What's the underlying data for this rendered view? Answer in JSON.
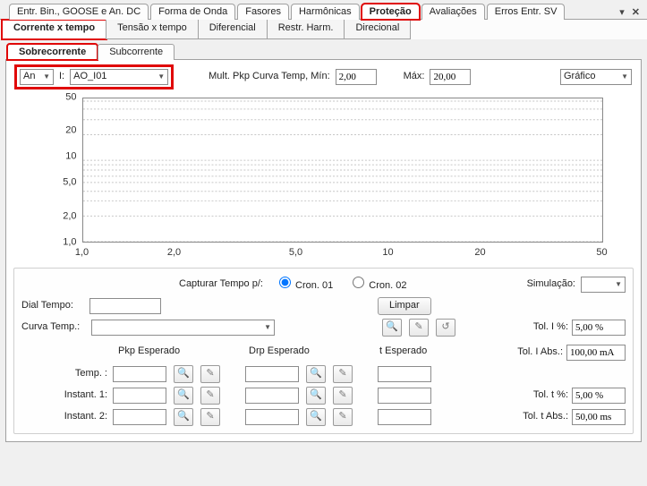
{
  "topTabs": {
    "t0": "Entr. Bin., GOOSE e An. DC",
    "t1": "Forma de Onda",
    "t2": "Fasores",
    "t3": "Harmônicas",
    "t4": "Proteção",
    "t5": "Avaliações",
    "t6": "Erros Entr. SV"
  },
  "subTabs": {
    "s0": "Corrente x tempo",
    "s1": "Tensão x tempo",
    "s2": "Diferencial",
    "s3": "Restr. Harm.",
    "s4": "Direcional"
  },
  "subSubTabs": {
    "u0": "Sobrecorrente",
    "u1": "Subcorrente"
  },
  "selectors": {
    "modeLabel": "An",
    "chanLabel": "I:",
    "chanValue": "AO_I01",
    "multLabel": "Mult. Pkp Curva Temp, Mín:",
    "multMin": "2,00",
    "maxLabel": "Máx:",
    "multMax": "20,00",
    "viewLabel": "Gráfico"
  },
  "chart_data": {
    "type": "line",
    "title": "",
    "xlabel": "",
    "ylabel": "",
    "x_ticks": [
      "1,0",
      "2,0",
      "5,0",
      "10",
      "20",
      "50"
    ],
    "y_ticks": [
      "1,0",
      "2,0",
      "5,0",
      "10",
      "20",
      "50"
    ],
    "xlim": [
      1,
      50
    ],
    "ylim": [
      1,
      50
    ],
    "xscale": "log",
    "yscale": "log",
    "series": []
  },
  "capture": {
    "label": "Capturar Tempo p/:",
    "opt1": "Cron. 01",
    "opt2": "Cron. 02",
    "selected": "Cron. 01",
    "simLabel": "Simulação:",
    "simValue": ""
  },
  "controls": {
    "dialLabel": "Dial Tempo:",
    "dialValue": "",
    "curveLabel": "Curva Temp.:",
    "curveValue": "",
    "clear": "Limpar",
    "pkpHeader": "Pkp Esperado",
    "drpHeader": "Drp Esperado",
    "tHeader": "t Esperado",
    "rowTemp": "Temp. :",
    "rowInst1": "Instant. 1:",
    "rowInst2": "Instant. 2:"
  },
  "tol": {
    "tolI": "Tol. I %:",
    "tolIval": "5,00 %",
    "tolIAbs": "Tol. I Abs.:",
    "tolIAbsVal": "100,00 mA",
    "tolT": "Tol. t %:",
    "tolTval": "5,00 %",
    "tolTAbs": "Tol. t Abs.:",
    "tolTAbsVal": "50,00 ms"
  }
}
